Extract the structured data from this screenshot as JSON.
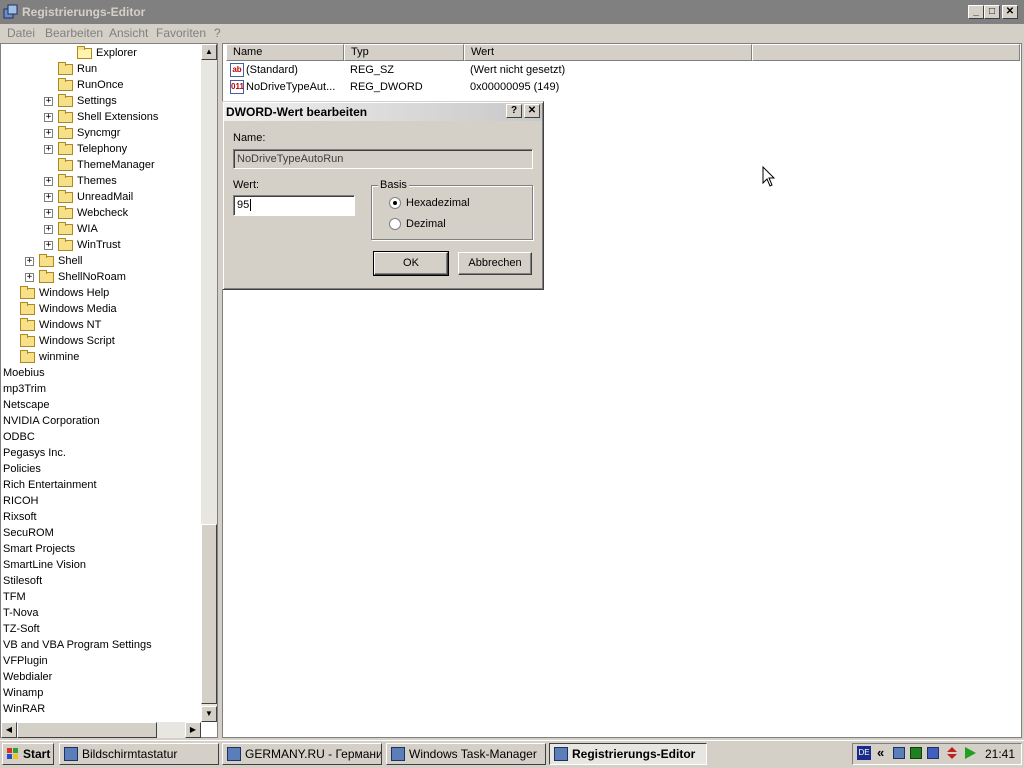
{
  "window": {
    "title": "Registrierungs-Editor"
  },
  "menu": [
    "Datei",
    "Bearbeiten",
    "Ansicht",
    "Favoriten",
    "?"
  ],
  "tree": [
    {
      "label": "Explorer",
      "level": 3,
      "expander": false,
      "open": true
    },
    {
      "label": "Run",
      "level": 2,
      "expander": false
    },
    {
      "label": "RunOnce",
      "level": 2,
      "expander": false
    },
    {
      "label": "Settings",
      "level": 2,
      "expander": true
    },
    {
      "label": "Shell Extensions",
      "level": 2,
      "expander": true
    },
    {
      "label": "Syncmgr",
      "level": 2,
      "expander": true
    },
    {
      "label": "Telephony",
      "level": 2,
      "expander": true
    },
    {
      "label": "ThemeManager",
      "level": 2,
      "expander": false
    },
    {
      "label": "Themes",
      "level": 2,
      "expander": true
    },
    {
      "label": "UnreadMail",
      "level": 2,
      "expander": true
    },
    {
      "label": "Webcheck",
      "level": 2,
      "expander": true
    },
    {
      "label": "WIA",
      "level": 2,
      "expander": true
    },
    {
      "label": "WinTrust",
      "level": 2,
      "expander": true
    },
    {
      "label": "Shell",
      "level": 1,
      "expander": true
    },
    {
      "label": "ShellNoRoam",
      "level": 1,
      "expander": true
    },
    {
      "label": "Windows Help",
      "level": 0,
      "expander": false
    },
    {
      "label": "Windows Media",
      "level": 0,
      "expander": false
    },
    {
      "label": "Windows NT",
      "level": 0,
      "expander": false
    },
    {
      "label": "Windows Script",
      "level": 0,
      "expander": false
    },
    {
      "label": "winmine",
      "level": 0,
      "expander": false
    },
    {
      "label": "Moebius",
      "level": -1
    },
    {
      "label": "mp3Trim",
      "level": -1
    },
    {
      "label": "Netscape",
      "level": -1
    },
    {
      "label": "NVIDIA Corporation",
      "level": -1
    },
    {
      "label": "ODBC",
      "level": -1
    },
    {
      "label": "Pegasys Inc.",
      "level": -1
    },
    {
      "label": "Policies",
      "level": -1
    },
    {
      "label": "Rich Entertainment",
      "level": -1
    },
    {
      "label": "RICOH",
      "level": -1
    },
    {
      "label": "Rixsoft",
      "level": -1
    },
    {
      "label": "SecuROM",
      "level": -1
    },
    {
      "label": "Smart Projects",
      "level": -1
    },
    {
      "label": "SmartLine Vision",
      "level": -1
    },
    {
      "label": "Stilesoft",
      "level": -1
    },
    {
      "label": "TFM",
      "level": -1
    },
    {
      "label": "T-Nova",
      "level": -1
    },
    {
      "label": "TZ-Soft",
      "level": -1
    },
    {
      "label": "VB and VBA Program Settings",
      "level": -1
    },
    {
      "label": "VFPlugin",
      "level": -1
    },
    {
      "label": "Webdialer",
      "level": -1
    },
    {
      "label": "Winamp",
      "level": -1
    },
    {
      "label": "WinRAR",
      "level": -1
    }
  ],
  "list": {
    "columns": [
      "Name",
      "Typ",
      "Wert"
    ],
    "rows": [
      {
        "icon": "ab",
        "name": "(Standard)",
        "type": "REG_SZ",
        "value": "(Wert nicht gesetzt)"
      },
      {
        "icon": "011",
        "name": "NoDriveTypeAut...",
        "type": "REG_DWORD",
        "value": "0x00000095 (149)"
      }
    ]
  },
  "dialog": {
    "title": "DWORD-Wert bearbeiten",
    "help_btn": "?",
    "close_btn": "✕",
    "name_label": "Name:",
    "name_value": "NoDriveTypeAutoRun",
    "value_label": "Wert:",
    "value_value": "95",
    "basis_label": "Basis",
    "radio_hex": "Hexadezimal",
    "radio_dec": "Dezimal",
    "selected_base": "Hexadezimal",
    "ok": "OK",
    "cancel": "Abbrechen"
  },
  "taskbar": {
    "start": "Start",
    "tasks": [
      {
        "label": "Bildschirmtastatur",
        "active": false
      },
      {
        "label": "GERMANY.RU - Германи...",
        "active": false
      },
      {
        "label": "Windows Task-Manager",
        "active": false
      },
      {
        "label": "Registrierungs-Editor",
        "active": true
      }
    ],
    "lang": "DE",
    "chevron": "«",
    "time": "21:41"
  }
}
